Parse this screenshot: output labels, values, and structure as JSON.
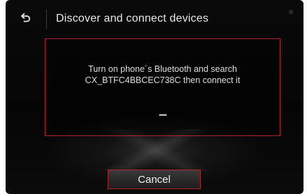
{
  "header": {
    "back_icon": "back-arrow-icon",
    "title": "Discover and connect devices"
  },
  "dialog": {
    "line1": "Turn on phone´s Bluetooth and search",
    "line2": "CX_BTFC4BBCEC738C then connect it",
    "progress": "•••••"
  },
  "actions": {
    "cancel_label": "Cancel"
  },
  "colors": {
    "accent_border": "#b3242a",
    "background": "#0a0a0a",
    "text": "#e8e8e8"
  }
}
